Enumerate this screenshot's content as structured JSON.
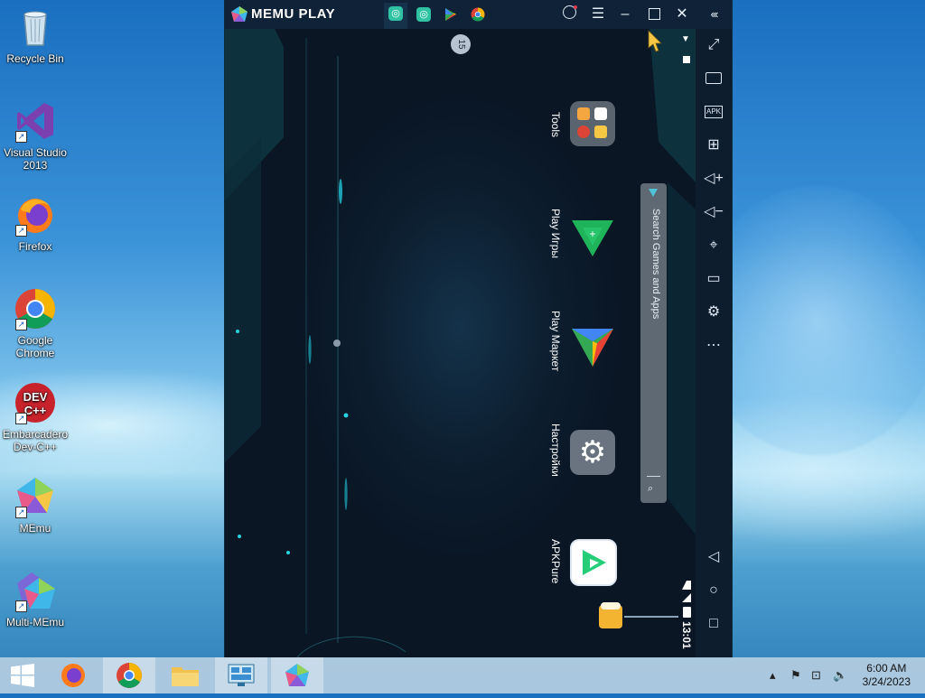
{
  "desktop": {
    "icons": [
      {
        "label_1": "Recycle Bin",
        "label_2": ""
      },
      {
        "label_1": "Visual Studio",
        "label_2": "2013"
      },
      {
        "label_1": "Firefox",
        "label_2": ""
      },
      {
        "label_1": "Google",
        "label_2": "Chrome"
      },
      {
        "label_1": "Embarcadero",
        "label_2": "Dev-C++"
      },
      {
        "label_1": "MEmu",
        "label_2": ""
      },
      {
        "label_1": "Multi-MEmu",
        "label_2": ""
      }
    ]
  },
  "emulator": {
    "title": "MEMU PLAY",
    "tab_icons": [
      "memu-app-icon",
      "memu-app-icon",
      "play-store-icon",
      "chrome-icon"
    ],
    "title_buttons": [
      "account-icon",
      "menu-icon",
      "minimize-icon",
      "maximize-icon",
      "close-icon",
      "collapse-sidebar-icon"
    ],
    "screen": {
      "speed_badge": "15",
      "apps": [
        {
          "label": "Tools"
        },
        {
          "label": "Play Игры"
        },
        {
          "label": "Play Маркет"
        },
        {
          "label": "Настройки"
        },
        {
          "label": "APKPure"
        }
      ],
      "search_placeholder": "Search Games and Apps",
      "status_time": "13:01"
    },
    "sidebar_buttons": [
      "fullscreen-icon",
      "keyboard-icon",
      "apk-icon",
      "add-window-icon",
      "volume-up-icon",
      "volume-down-icon",
      "location-icon",
      "folder-icon",
      "settings-icon",
      "more-icon",
      "back-icon",
      "home-icon",
      "recents-icon"
    ],
    "apk_label": "APK"
  },
  "taskbar": {
    "items": [
      "start-button",
      "firefox",
      "chrome",
      "file-explorer",
      "control-panel",
      "memu"
    ],
    "clock_time": "6:00 AM",
    "clock_date": "3/24/2023"
  },
  "colors": {
    "memu_accent": "#2fc3a4",
    "play_games_green": "#1fb35a",
    "settings_gray": "#6a7480"
  }
}
